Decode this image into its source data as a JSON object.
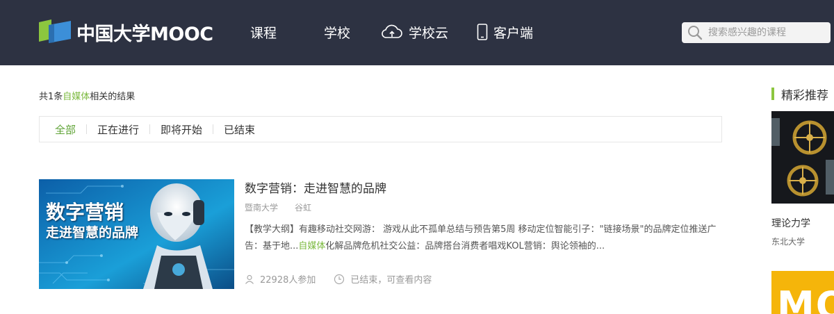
{
  "header": {
    "logo_text": "中国大学MOOC",
    "nav": [
      {
        "label": "课程"
      },
      {
        "label": "学校"
      },
      {
        "label": "学校云",
        "icon": "cloud-upload-icon"
      },
      {
        "label": "客户端",
        "icon": "mobile-phone-icon"
      }
    ],
    "search": {
      "placeholder": "搜索感兴趣的课程",
      "icon": "search-icon"
    }
  },
  "results": {
    "prefix": "共1条",
    "keyword": "自媒体",
    "suffix": "相关的结果"
  },
  "filter_tabs": [
    {
      "label": "全部",
      "active": true
    },
    {
      "label": "正在进行",
      "active": false
    },
    {
      "label": "即将开始",
      "active": false
    },
    {
      "label": "已结束",
      "active": false
    }
  ],
  "course": {
    "title": "数字营销：走进智慧的品牌",
    "image_text_line1": "数字营销",
    "image_text_line2": "走进智慧的品牌",
    "school": "暨南大学",
    "teacher": "谷虹",
    "desc_part1": "【教学大纲】有趣移动社交网游： 游戏从此不孤单总结与预告第5周 移动定位智能引子：\"链接场景\"的品牌定位推送广告：基于地...",
    "desc_keyword": "自媒体",
    "desc_part2": "化解品牌危机社交公益：品牌搭台消费者唱戏KOL营销：舆论领袖的...",
    "enrolled": "22928人参加",
    "status": "已结束，可查看内容"
  },
  "sidebar": {
    "title": "精彩推荐",
    "items": [
      {
        "name": "理论力学",
        "school": "东北大学"
      }
    ],
    "second_image_text": "MO"
  },
  "colors": {
    "header_bg": "#2d3242",
    "accent_green": "#79b83b",
    "side_bar_green": "#8cc63f"
  }
}
